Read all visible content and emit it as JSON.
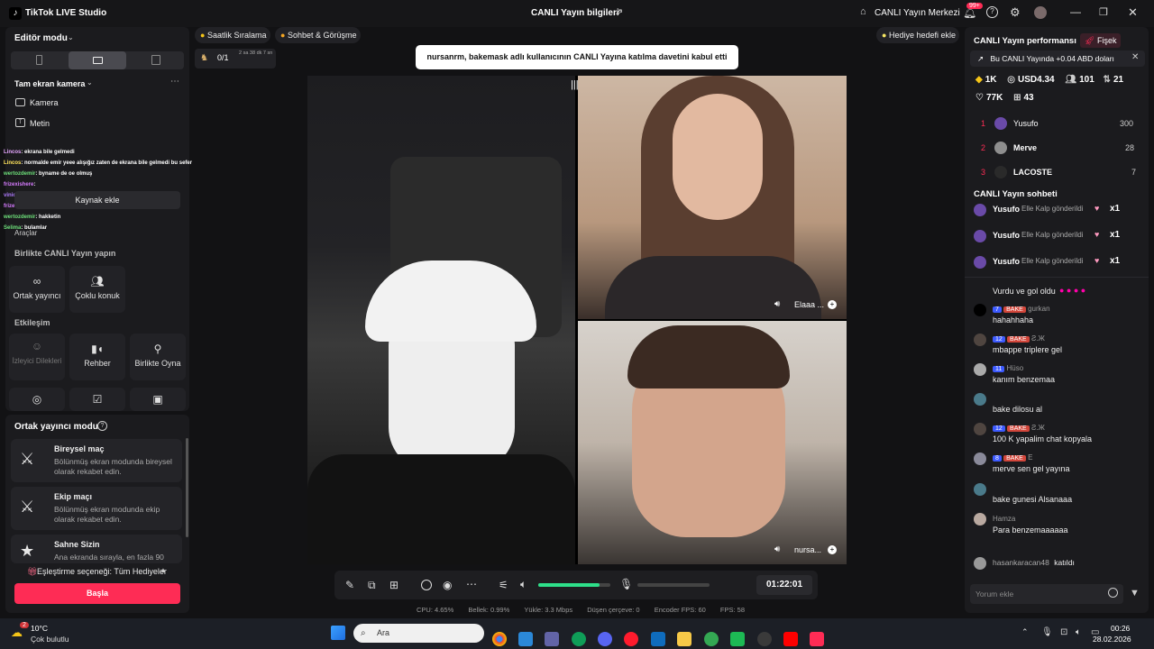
{
  "app": {
    "title": "TikTok LIVE Studio",
    "center_title": "CANLI Yayın bilgileri",
    "live_center": "CANLI Yayın Merkezi",
    "notif_count": "99+"
  },
  "left": {
    "editor_mode": "Editör modu",
    "fullscreen_camera": "Tam ekran kamera",
    "camera": "Kamera",
    "text": "Metin",
    "add_source": "Kaynak ekle",
    "overlay_label": "Araçlar",
    "chat_overlay": [
      {
        "user": "Lincos",
        "text": ": ekrana bile gelmedi",
        "color": "#e6a7ff"
      },
      {
        "user": "Lincos",
        "text": ": normalde emir yeee alışığız zaten de ekrana bile gelmedi bu sefer",
        "color": "#ffe45c"
      },
      {
        "user": "wertozdemir",
        "text": ": byname de oe olmuş",
        "color": "#6ee07a"
      },
      {
        "user": "frizexishere",
        "text": ":",
        "color": "#d67bff"
      },
      {
        "user": "viniciab",
        "text": ":",
        "color": "#b07bff"
      },
      {
        "user": "frizexishere",
        "text": ":",
        "color": "#d67bff"
      },
      {
        "user": "wertozdemir",
        "text": ": hakketin",
        "color": "#6ee07a"
      },
      {
        "user": "Selima",
        "text": ": bulamlar",
        "color": "#6ee07a"
      }
    ],
    "together_title": "Birlikte CANLI Yayın yapın",
    "cohost": "Ortak yayıncı",
    "multi_guest": "Çoklu konuk",
    "interaction_title": "Etkileşim",
    "viewer_requests": "İzleyici Dilekleri",
    "guide": "Rehber",
    "play_together": "Birlikte Oyna",
    "cohost_mode": "Ortak yayıncı modu",
    "modes": [
      {
        "title": "Bireysel maç",
        "desc": "Bölünmüş ekran modunda bireysel olarak rekabet edin."
      },
      {
        "title": "Ekip maçı",
        "desc": "Bölünmüş ekran modunda ekip olarak rekabet edin."
      },
      {
        "title": "Sahne Sizin",
        "desc": "Ana ekranda sırayla, en fazla 90"
      }
    ],
    "match_option": "Eşleştirme seçeneği: Tüm Hediyeler",
    "start": "Başla"
  },
  "top": {
    "hourly_rank": "Saatlik Sıralama",
    "chat_meet": "Sohbet & Görüşme",
    "gift_goal": "Hediye hedefi ekle",
    "goal_count": "0/1",
    "goal_time": "2 sa 38 dk 7 sn",
    "toast": "nursanrm, bakemask adlı kullanıcının CANLI Yayına katılma davetini kabul etti"
  },
  "stage": {
    "guest1": "Elaaa ...",
    "guest2": "nursa..."
  },
  "controls": {
    "timer": "01:22:01",
    "volume_pct": 85
  },
  "stats": {
    "cpu": "CPU: 4.65%",
    "mem": "Bellek: 0.99%",
    "upload": "Yükle: 3.3 Mbps",
    "dropped": "Düşen çerçeve: 0",
    "encoder_fps": "Encoder FPS: 60",
    "fps": "FPS: 58"
  },
  "right": {
    "perf_title": "CANLI Yayın performansı",
    "rocket": "Fişek",
    "banner": "Bu CANLI Yayında +0.04 ABD doları",
    "diamonds": "1K",
    "usd": "USD4.34",
    "viewers": "101",
    "gifters": "21",
    "likes": "77K",
    "shares": "43",
    "ranking": [
      {
        "rank": "1",
        "name": "Yusufo",
        "score": "300"
      },
      {
        "rank": "2",
        "name": "Merve",
        "score": "28"
      },
      {
        "rank": "3",
        "name": "LACOSTE",
        "score": "7"
      }
    ],
    "chat_title": "CANLI Yayın sohbeti",
    "gifts": [
      {
        "user": "Yusufo",
        "text": "Elle Kalp gönderildi",
        "count": "x1"
      },
      {
        "user": "Yusufo",
        "text": "Elle Kalp gönderildi",
        "count": "x1"
      },
      {
        "user": "Yusufo",
        "text": "Elle Kalp gönderildi",
        "count": "x1"
      }
    ],
    "first_msg": "Vurdu ve gol oldu",
    "messages": [
      {
        "badge": "7",
        "team": "BAKE",
        "user": "gurkan",
        "text": "hahahhaha"
      },
      {
        "badge": "12",
        "team": "BAKE",
        "user": "Ƨ.Ж",
        "text": "mbappe triplere gel"
      },
      {
        "badge": "11",
        "team": "",
        "user": "Hüso",
        "text": "kanım benzemaa"
      },
      {
        "badge": "",
        "team": "",
        "user": "",
        "text": "bake dilosu al"
      },
      {
        "badge": "12",
        "team": "BAKE",
        "user": "Ƨ.Ж",
        "text": "100 K yapalim chat kopyala"
      },
      {
        "badge": "8",
        "team": "BAKE",
        "user": "E",
        "text": "merve sen gel yayına"
      },
      {
        "badge": "",
        "team": "",
        "user": "",
        "text": "bake gunesi Alsanaaa"
      },
      {
        "badge": "",
        "team": "",
        "user": "Hamza",
        "text": "Para benzemaaaaaa"
      }
    ],
    "joined_user": "hasankaracan48",
    "joined_text": "katıldı",
    "comment_placeholder": "Yorum ekle"
  },
  "taskbar": {
    "weather_temp": "10°C",
    "weather_desc": "Çok bulutlu",
    "weather_badge": "2",
    "search": "Ara",
    "time": "00:26",
    "date": "28.02.2026"
  },
  "colors": {
    "accent": "#fe2c55",
    "cyan": "#25f4ee",
    "green": "#2ee08a"
  }
}
